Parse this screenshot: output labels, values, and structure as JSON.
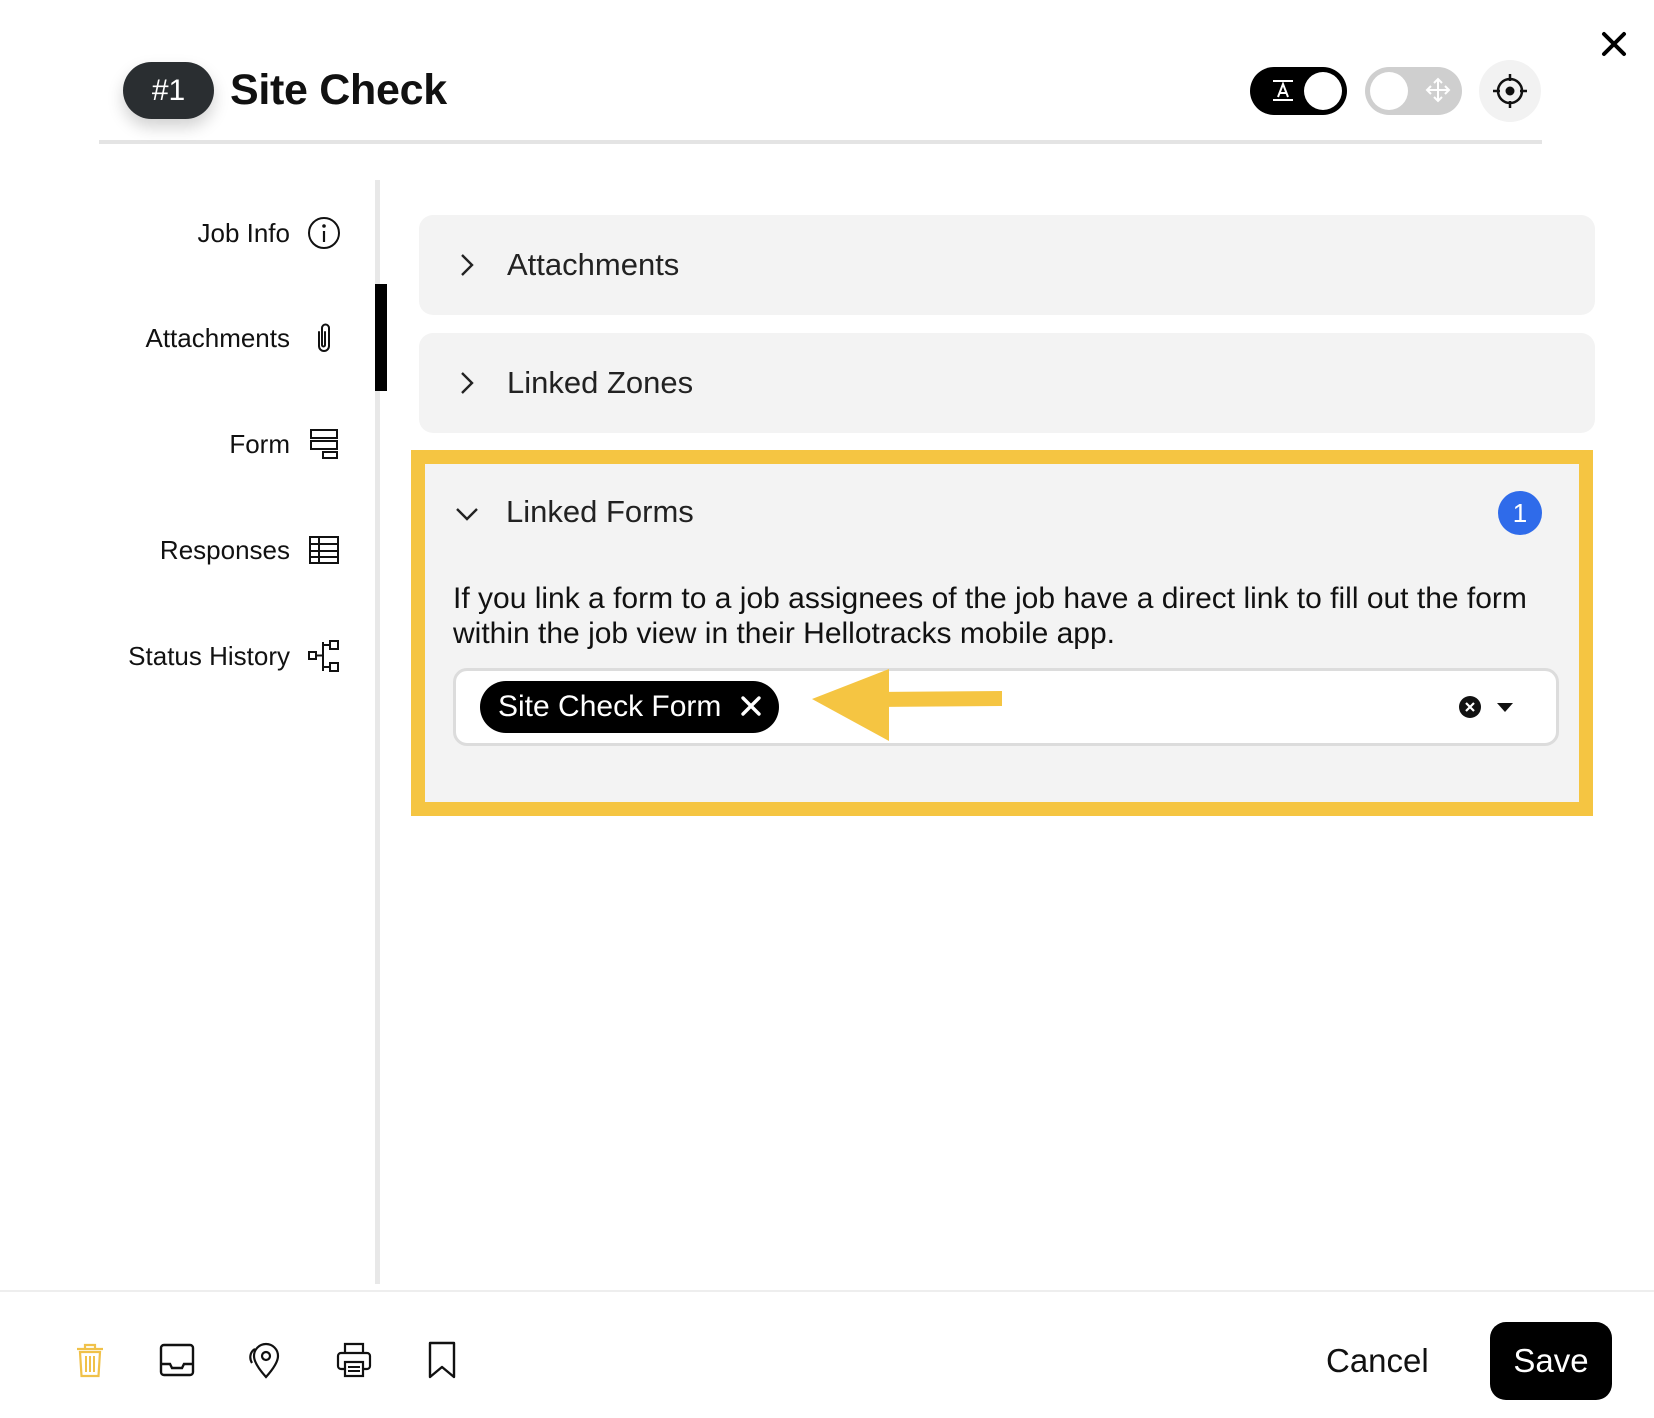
{
  "header": {
    "job_number": "#1",
    "title": "Site Check",
    "text_toggle_icon": "text-format-icon",
    "move_toggle_icon": "move-icon",
    "locate_icon": "crosshair-icon",
    "close_icon": "close-icon"
  },
  "sidebar": {
    "active": "Attachments",
    "items": [
      {
        "label": "Job Info",
        "icon": "info-icon"
      },
      {
        "label": "Attachments",
        "icon": "paperclip-icon"
      },
      {
        "label": "Form",
        "icon": "form-icon"
      },
      {
        "label": "Responses",
        "icon": "table-icon"
      },
      {
        "label": "Status History",
        "icon": "status-history-icon"
      }
    ]
  },
  "main": {
    "sections": [
      {
        "title": "Attachments",
        "expanded": false
      },
      {
        "title": "Linked Zones",
        "expanded": false
      },
      {
        "title": "Linked Forms",
        "expanded": true
      }
    ],
    "linked_forms": {
      "count": "1",
      "description": "If you link a form to a job assignees of the job have a direct link to fill out the form within the job view in their Hellotracks mobile app.",
      "selected_form": "Site Check Form"
    },
    "highlight_color": "#f5c542",
    "badge_color": "#2f6bea"
  },
  "footer": {
    "icons": [
      "trash-icon",
      "inbox-icon",
      "location-pin-icon",
      "printer-icon",
      "bookmark-icon"
    ],
    "cancel_label": "Cancel",
    "save_label": "Save"
  }
}
